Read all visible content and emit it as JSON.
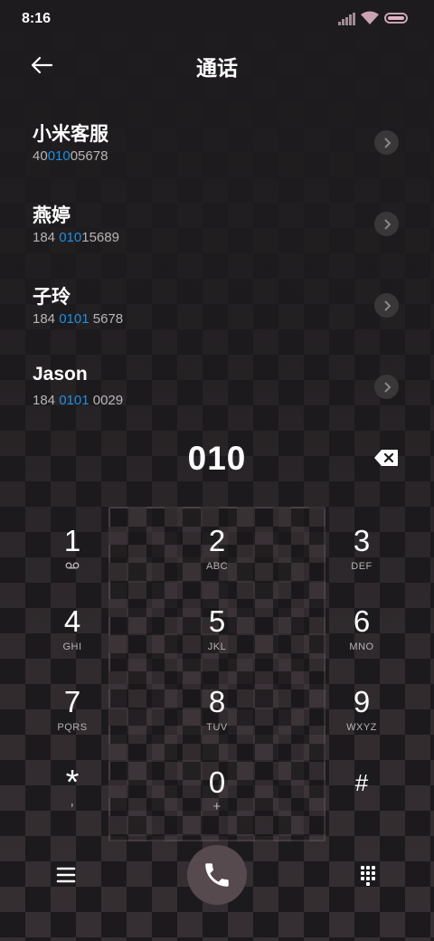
{
  "status_bar": {
    "time": "8:16"
  },
  "header": {
    "title": "通话"
  },
  "contacts": [
    {
      "name": "小米客服",
      "num_pre": "40",
      "num_hl": "010",
      "num_post": "05678"
    },
    {
      "name": "燕婷",
      "num_pre": "184 ",
      "num_hl": "010",
      "num_post": "15689"
    },
    {
      "name": "子玲",
      "num_pre": "184 ",
      "num_hl": "0101",
      "num_post": " 5678"
    },
    {
      "name": "Jason",
      "num_pre": "184 ",
      "num_hl": "0101",
      "num_post": " 0029"
    }
  ],
  "dialer": {
    "entered": "010"
  },
  "keypad": [
    {
      "digit": "1",
      "letters": ""
    },
    {
      "digit": "2",
      "letters": "ABC"
    },
    {
      "digit": "3",
      "letters": "DEF"
    },
    {
      "digit": "4",
      "letters": "GHI"
    },
    {
      "digit": "5",
      "letters": "JKL"
    },
    {
      "digit": "6",
      "letters": "MNO"
    },
    {
      "digit": "7",
      "letters": "PQRS"
    },
    {
      "digit": "8",
      "letters": "TUV"
    },
    {
      "digit": "9",
      "letters": "WXYZ"
    },
    {
      "digit": "*",
      "letters": ","
    },
    {
      "digit": "0",
      "letters": "+"
    },
    {
      "digit": "#",
      "letters": ""
    }
  ],
  "colors": {
    "highlight": "#1e8fe1",
    "call_button": "#564a4f"
  },
  "icons": {
    "back": "back-arrow-icon",
    "backspace": "backspace-icon",
    "voicemail": "voicemail-icon",
    "menu": "menu-icon",
    "call": "phone-icon",
    "dialpad": "dialpad-icon"
  }
}
